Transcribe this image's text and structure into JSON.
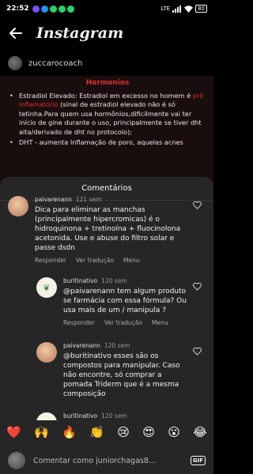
{
  "status_bar": {
    "time": "22:52",
    "notification_colors": [
      "#7c4dff",
      "#2196f3",
      "#25d366",
      "#25d366",
      "#25d366"
    ],
    "signal": "LTE",
    "battery": "80"
  },
  "app_bar": {
    "title": "Instagram"
  },
  "post": {
    "author": "zuccarocoach",
    "heading": "Hormonios",
    "bullets": [
      {
        "lead": "Estradiol Elevado: Estradiol em excesso no homem é ",
        "emph": "pró inflamatório",
        "rest": " (sinal de estradiol elevado não é só tetinha.Para quem usa hormônios,dificilmente vai ter início de gine durante o uso, principalmente se tiver dht alta/derivado de dht no protocolo);"
      },
      {
        "lead": "DHT - aumenta Inflamação de poro, aquelas acnes",
        "emph": "",
        "rest": ""
      }
    ]
  },
  "sheet": {
    "title": "Comentários"
  },
  "comments": [
    {
      "username": "paivarenann",
      "time": "121 sem",
      "text": "Dica para eliminar as manchas (principalmente hipercromicas) é o hidroquinona + tretinoína + fluocinolona acetonida. Use e abuse do filtro solar e passe dsdn",
      "reply": "Responder",
      "translate": "Ver tradução",
      "menu": "Menu"
    },
    {
      "username": "buritinativo",
      "time": "120 sem",
      "text": "@paivarenann tem algum produto se farmácia com essa fórmula? Ou usa mais de um / manipula ?",
      "reply": "Responder",
      "translate": "Ver tradução",
      "menu": "Menu"
    },
    {
      "username": "paivarenann",
      "time": "120 sem",
      "text": "@buritinativo esses são os compostos para manipular. Caso não encontre, só comprar a pomada Triderm que é a mesma composição",
      "reply": "",
      "translate": "",
      "menu": ""
    },
    {
      "username": "buritinativo",
      "time": "120 sem",
      "text": "",
      "reply": "",
      "translate": "",
      "menu": ""
    }
  ],
  "emoji_bar": [
    "❤️",
    "🙌",
    "🔥",
    "👏",
    "😢",
    "😍",
    "😮",
    "😂"
  ],
  "composer": {
    "placeholder": "Comentar como juniorchagas8...",
    "gif_label": "GIF"
  }
}
